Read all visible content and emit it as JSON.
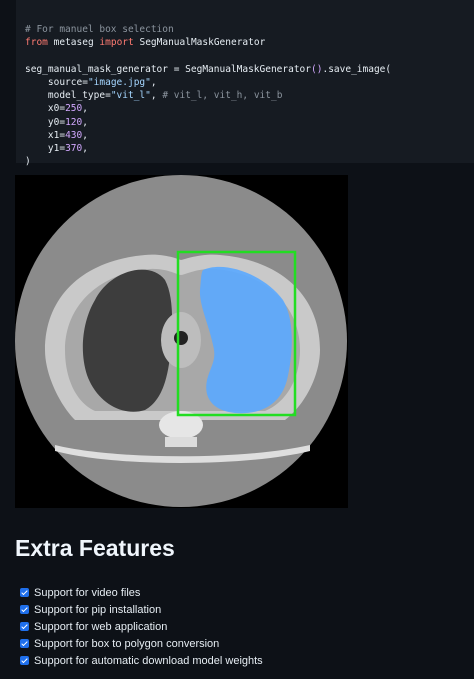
{
  "code": {
    "comment": "# For manuel box selection",
    "import_from": "from",
    "import_module": "metaseg",
    "import_kw": "import",
    "import_name": "SegManualMaskGenerator",
    "assign_var": "seg_manual_mask_generator",
    "assign_eq": " = ",
    "class_name": "SegManualMaskGenerator",
    "call_open": "()",
    "method": ".save_image(",
    "arg_source_key": "source=",
    "arg_source_val": "\"image.jpg\"",
    "arg_model_key": "model_type=",
    "arg_model_val": "\"vit_l\"",
    "arg_model_comment": "# vit_l, vit_h, vit_b",
    "x0_key": "x0=",
    "x0_val": "250",
    "y0_key": "y0=",
    "y0_val": "120",
    "x1_key": "x1=",
    "x1_val": "430",
    "y1_key": "y1=",
    "y1_val": "370",
    "close": ")"
  },
  "image": {
    "alt": "CT scan with segmentation mask",
    "mask_color": "#5aa9ff",
    "box_color": "#22dd22"
  },
  "features": {
    "title": "Extra Features",
    "items": [
      "Support for video files",
      "Support for pip installation",
      "Support for web application",
      "Support for box to polygon conversion",
      "Support for automatic download model weights"
    ]
  }
}
